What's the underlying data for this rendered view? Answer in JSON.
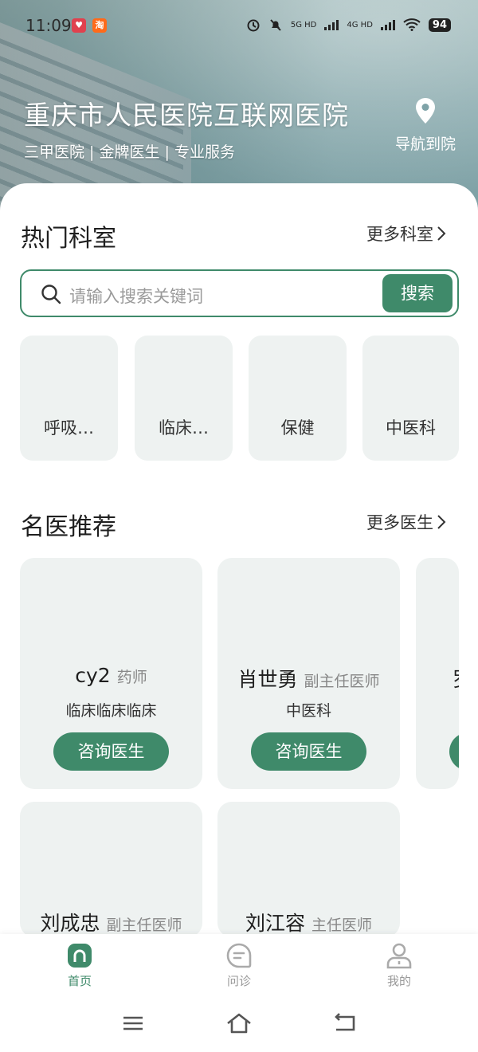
{
  "status_bar": {
    "time": "11:09",
    "battery": "94",
    "net1": "5G HD",
    "net2": "4G HD"
  },
  "hospital": {
    "name": "重庆市人民医院互联网医院",
    "tagline": "三甲医院 | 金牌医生 | 专业服务",
    "nav_label": "导航到院"
  },
  "departments": {
    "title": "热门科室",
    "more_label": "更多科室",
    "search_placeholder": "请输入搜索关键词",
    "search_button": "搜索",
    "items": [
      {
        "label": "呼吸…"
      },
      {
        "label": "临床…"
      },
      {
        "label": "保健"
      },
      {
        "label": "中医科"
      }
    ]
  },
  "doctors": {
    "title": "名医推荐",
    "more_label": "更多医生",
    "consult_label": "咨询医生",
    "items": [
      {
        "name": "cy2",
        "title": "药师",
        "dept": "临床临床临床"
      },
      {
        "name": "肖世勇",
        "title": "副主任医师",
        "dept": "中医科"
      },
      {
        "name": "罗",
        "title": "",
        "dept": ""
      },
      {
        "name": "刘成忠",
        "title": "副主任医师",
        "dept": ""
      },
      {
        "name": "刘江容",
        "title": "主任医师",
        "dept": ""
      }
    ]
  },
  "tabbar": {
    "items": [
      {
        "label": "首页",
        "active": true
      },
      {
        "label": "问诊",
        "active": false
      },
      {
        "label": "我的",
        "active": false
      }
    ]
  },
  "colors": {
    "accent": "#3f8a6a",
    "card_bg": "#eef2f1"
  }
}
